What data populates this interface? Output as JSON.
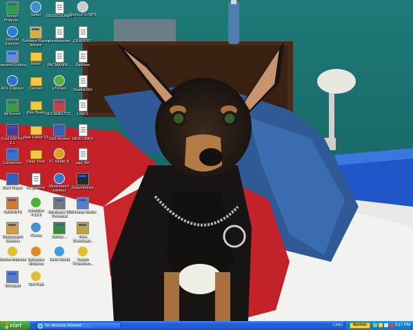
{
  "desktop": {
    "icons": [
      {
        "label": "Norton Protecte...",
        "kind": "exe",
        "color": "#2f9c4a"
      },
      {
        "label": "Safari",
        "kind": "round",
        "color": "#3b8fd6"
      },
      {
        "label": "DRDRCHUNKY",
        "kind": "doc",
        "color": "#ffffff"
      },
      {
        "label": "Shortcut to MP3",
        "kind": "round",
        "color": "#cccccc"
      },
      {
        "label": "Internet Explorer",
        "kind": "round",
        "color": "#2a7be0"
      },
      {
        "label": "Software Repair Wizard",
        "kind": "exe",
        "color": "#d1b044"
      },
      {
        "label": "ghostspasted",
        "kind": "doc",
        "color": "#ffffff"
      },
      {
        "label": "_GEAREXT...",
        "kind": "doc",
        "color": "#ffffff"
      },
      {
        "label": "canvens Eudora",
        "kind": "exe",
        "color": "#6a8fc4"
      },
      {
        "label": "Beats",
        "kind": "folder",
        "color": "#f4c64a"
      },
      {
        "label": "PACMANPA...",
        "kind": "doc",
        "color": "#ffffff"
      },
      {
        "label": "DatAlbet",
        "kind": "doc",
        "color": "#ffffff"
      },
      {
        "label": "AOL Explorer",
        "kind": "round",
        "color": "#2f6fd0"
      },
      {
        "label": "Camren",
        "kind": "folder",
        "color": "#f4c64a"
      },
      {
        "label": "µTorrent",
        "kind": "round",
        "color": "#5aae3a"
      },
      {
        "label": "Deathill360",
        "kind": "doc",
        "color": "#ffffff"
      },
      {
        "label": "BitTorrent",
        "kind": "exe",
        "color": "#3b9a3b"
      },
      {
        "label": "iDes Beats",
        "kind": "folder",
        "color": "#f4c64a"
      },
      {
        "label": "RECAMRUT21_Instrum...",
        "kind": "exe",
        "color": "#c44444"
      },
      {
        "label": "LINKS",
        "kind": "doc",
        "color": "#ffffff"
      },
      {
        "label": "Cool Edit Pro 2.1",
        "kind": "exe",
        "color": "#4b3b8f"
      },
      {
        "label": "New Folder 23",
        "kind": "folder",
        "color": "#f4c64a"
      },
      {
        "label": "DivX Movies",
        "kind": "exe",
        "color": "#3a5fae"
      },
      {
        "label": "NEW LINKS",
        "kind": "doc",
        "color": "#ffffff"
      },
      {
        "label": "Connection",
        "kind": "exe",
        "color": "#3c70c4"
      },
      {
        "label": "Okay Tonic",
        "kind": "folder",
        "color": "#f4c64a"
      },
      {
        "label": "FL Studio 8",
        "kind": "round",
        "color": "#e0a020"
      },
      {
        "label": "pad_file",
        "kind": "doc",
        "color": "#ffffff"
      },
      {
        "label": "DivX Player",
        "kind": "exe",
        "color": "#3a5fae"
      },
      {
        "label": "FL grammy",
        "kind": "doc",
        "color": "#ffffff"
      },
      {
        "label": "Musicmatch Jukebox",
        "kind": "round",
        "color": "#3a77c9"
      },
      {
        "label": "Documentary",
        "kind": "exe",
        "color": "#2a2a2a"
      },
      {
        "label": "CASHETS",
        "kind": "exe",
        "color": "#d57a2a"
      },
      {
        "label": "LimeWire 4.12.6",
        "kind": "round",
        "color": "#4fae3a"
      },
      {
        "label": "Ad-Aware SE Personal",
        "kind": "exe",
        "color": "#777777"
      },
      {
        "label": "Winamp Studio",
        "kind": "exe",
        "color": "#5a7fc0"
      },
      {
        "label": "Musicmatch Jukebox",
        "kind": "exe",
        "color": "#d0a040"
      },
      {
        "label": "iTunes",
        "kind": "round",
        "color": "#4a8fd0"
      },
      {
        "label": "Stimsk ...",
        "kind": "exe",
        "color": "#3a8a3a"
      },
      {
        "label": "Free Download...",
        "kind": "exe",
        "color": "#c0a040"
      },
      {
        "label": "Norton Antivirus",
        "kind": "round",
        "color": "#e0c030"
      },
      {
        "label": "Symantec Antivirus",
        "kind": "round",
        "color": "#e08a20"
      },
      {
        "label": "Hello World",
        "kind": "round",
        "color": "#3aa0e0"
      },
      {
        "label": "Norton Protection...",
        "kind": "round",
        "color": "#e0c030"
      },
      {
        "label": "Wordpad",
        "kind": "exe",
        "color": "#5a7fc0"
      },
      {
        "label": "Get Paid",
        "kind": "round",
        "color": "#e0c030"
      }
    ]
  },
  "taskbar": {
    "start_label": "start",
    "task_label": "No Mutants Allowed :: ...",
    "links_label": "Links",
    "tray_norton": "Norton",
    "clock": "3:17 PM"
  },
  "colors": {
    "taskbar_blue": "#245edc",
    "start_green": "#3c9a32",
    "tray_blue": "#0f7fd6",
    "wall_teal": "#1a6f6c"
  }
}
